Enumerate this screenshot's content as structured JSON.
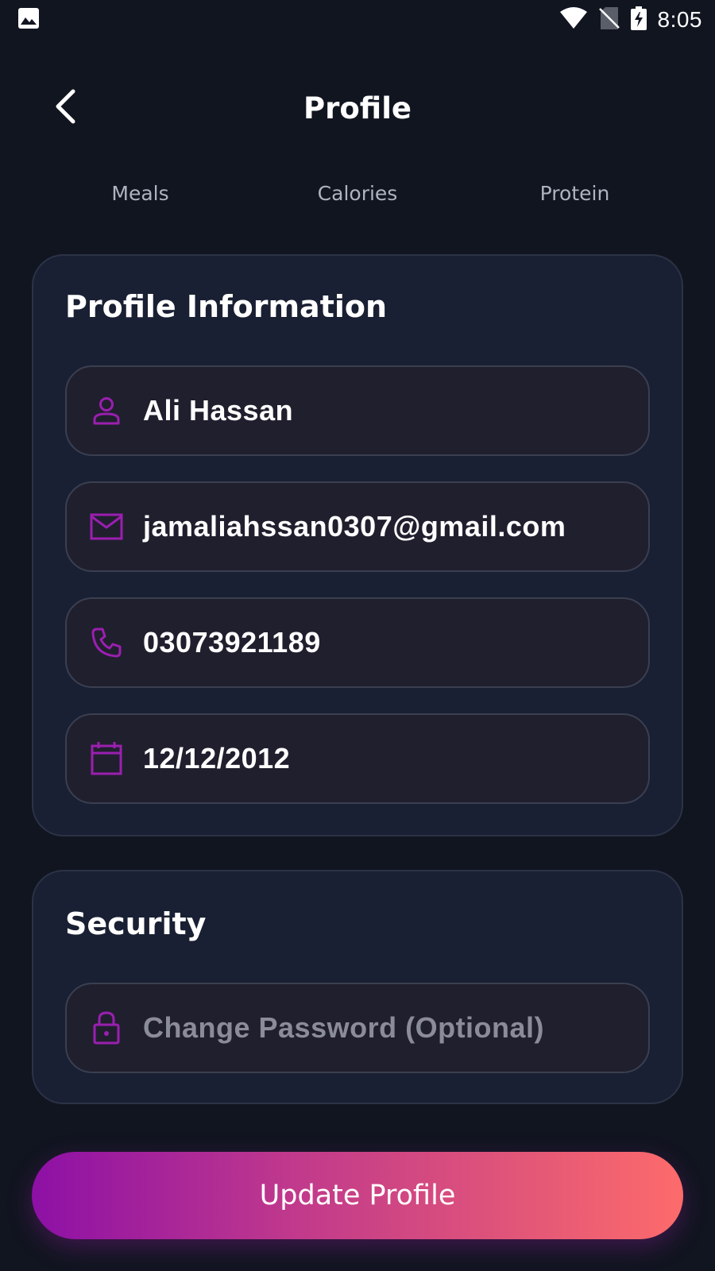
{
  "status_bar": {
    "time": "8:05",
    "icons": [
      "image-icon",
      "wifi-icon",
      "no-sim-icon",
      "battery-charging-icon"
    ]
  },
  "header": {
    "title": "Profile",
    "back_icon": "chevron-left-icon"
  },
  "tabs": [
    {
      "label": "Meals"
    },
    {
      "label": "Calories"
    },
    {
      "label": "Protein"
    }
  ],
  "profile_card": {
    "title": "Profile Information",
    "fields": {
      "name": {
        "value": "Ali Hassan",
        "icon": "person-icon"
      },
      "email": {
        "value": "jamaliahssan0307@gmail.com",
        "icon": "mail-icon"
      },
      "phone": {
        "value": "03073921189",
        "icon": "phone-icon"
      },
      "dob": {
        "value": "12/12/2012",
        "icon": "calendar-icon"
      }
    }
  },
  "security_card": {
    "title": "Security",
    "password": {
      "placeholder": "Change Password (Optional)",
      "icon": "lock-icon"
    }
  },
  "update_button": {
    "label": "Update Profile"
  },
  "colors": {
    "background": "#111520",
    "card": "#1a2033",
    "field": "#201f2e",
    "accent_icon": "#9b1fb0",
    "gradient_start": "#8d10a6",
    "gradient_end": "#fd6b6b",
    "tab_text": "#aeb3bf",
    "placeholder": "#8a8d99"
  }
}
